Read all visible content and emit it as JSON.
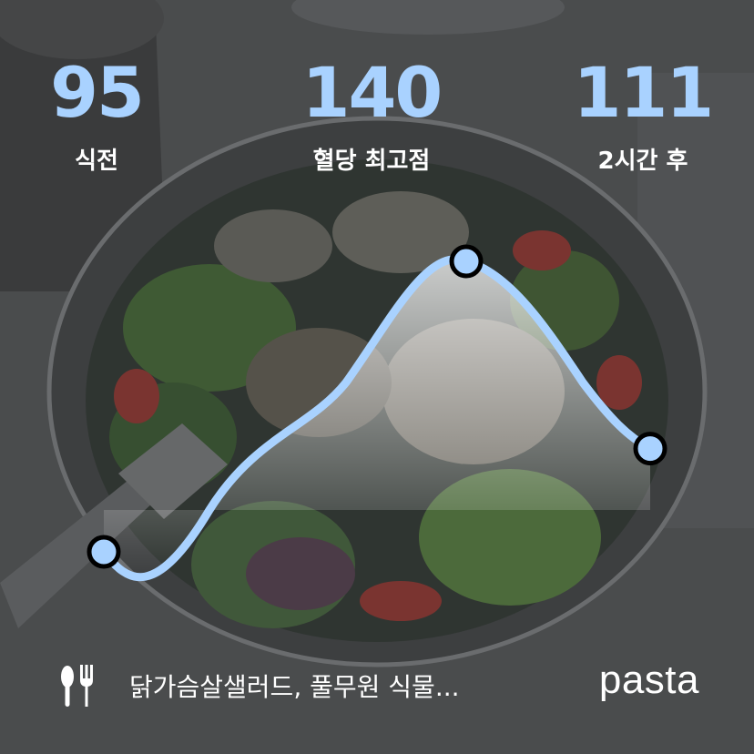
{
  "stats": {
    "before": {
      "value": "95",
      "label": "식전"
    },
    "peak": {
      "value": "140",
      "label": "혈당 최고점"
    },
    "after": {
      "value": "111",
      "label": "2시간 후"
    }
  },
  "curve": {
    "readings": [
      95,
      140,
      111
    ],
    "color": "#a9d2ff"
  },
  "footer": {
    "meal_icon": "fork-knife-icon",
    "food_text": "닭가슴살샐러드, 풀무원 식물...",
    "brand": "pasta"
  },
  "colors": {
    "accent": "#a9d2ff",
    "text": "#ffffff"
  }
}
